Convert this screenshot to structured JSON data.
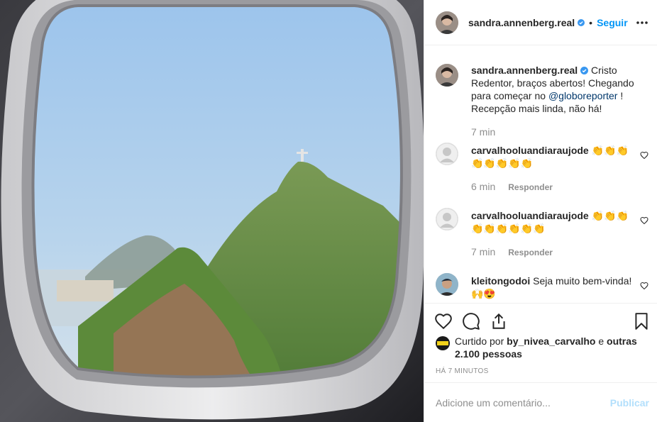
{
  "post": {
    "image_alt": "Vista da janela do avião: Cristo Redentor sobre o Corcovado"
  },
  "header": {
    "username": "sandra.annenberg.real",
    "separator": "•",
    "follow_label": "Seguir",
    "more_icon": "more-horizontal-icon"
  },
  "caption": {
    "username": "sandra.annenberg.real",
    "text_before": " Cristo Redentor, braços abertos! Chegando para começar no ",
    "mention": "@globoreporter",
    "text_after": " ! Recepção mais linda, não há!",
    "time": "7 min"
  },
  "comments": [
    {
      "username": "carvalhooluandiaraujode",
      "text": " 👏👏👏👏👏👏👏👏",
      "time": "6 min",
      "reply_label": "Responder"
    },
    {
      "username": "carvalhooluandiaraujode",
      "text": " 👏👏👏👏👏👏👏👏👏",
      "time": "7 min",
      "reply_label": "Responder"
    },
    {
      "username": "kleitongodoi",
      "text": " Seja muito bem-vinda!🙌😍"
    }
  ],
  "likes": {
    "prefix": "Curtido por ",
    "user": "by_nivea_carvalho",
    "middle": " e ",
    "others": "outras 2.100 pessoas"
  },
  "timestamp": "HÁ 7 MINUTOS",
  "add_comment": {
    "placeholder": "Adicione um comentário...",
    "publish_label": "Publicar"
  },
  "colors": {
    "accent": "#0095f6",
    "publish_disabled": "#b2dffc",
    "muted": "#8e8e8e"
  }
}
